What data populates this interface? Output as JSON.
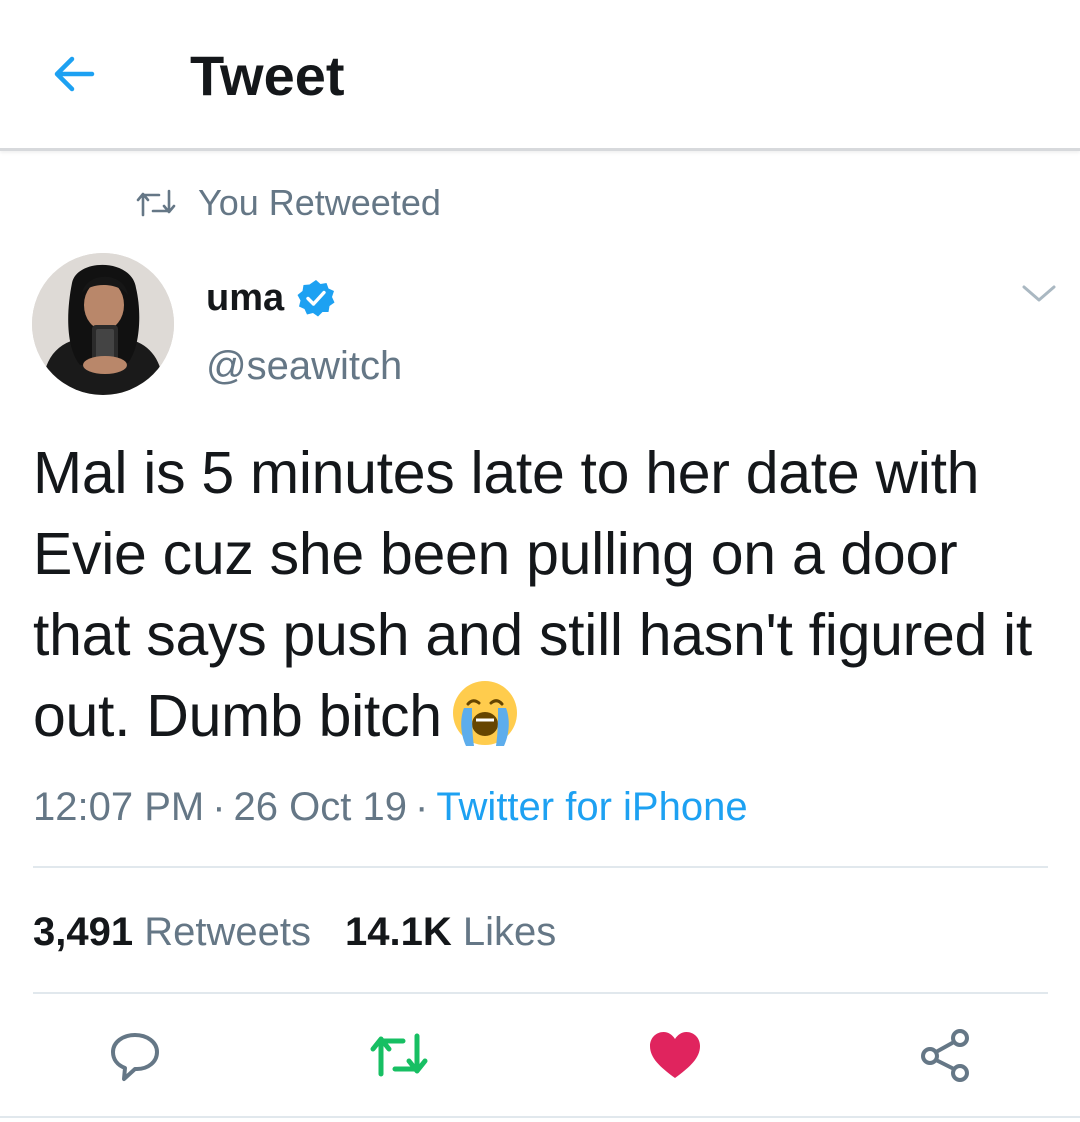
{
  "header": {
    "back_icon": "arrow-left-icon",
    "title": "Tweet"
  },
  "retweet_context": {
    "icon": "retweet-icon",
    "label": "You Retweeted"
  },
  "tweet": {
    "author": {
      "name": "uma",
      "handle": "@seawitch",
      "verified": true
    },
    "text": "Mal is 5 minutes late to her date with Evie cuz she been pulling on a door that says push and still hasn't figured it out. Dumb bitch",
    "emoji": "loudly-crying-face",
    "time": "12:07 PM",
    "date": "26 Oct 19",
    "separator": "·",
    "source": "Twitter for iPhone",
    "retweet_count": "3,491",
    "retweet_label": "Retweets",
    "like_count": "14.1K",
    "like_label": "Likes"
  },
  "actions": [
    {
      "icon": "reply-icon"
    },
    {
      "icon": "retweet-icon",
      "active": true
    },
    {
      "icon": "heart-icon",
      "active": true
    },
    {
      "icon": "share-icon"
    }
  ],
  "colors": {
    "twitter_blue": "#1da1f2",
    "retweet_green": "#17bf63",
    "like_red": "#e0245e",
    "secondary_text": "#657786",
    "primary_text": "#14171a"
  }
}
